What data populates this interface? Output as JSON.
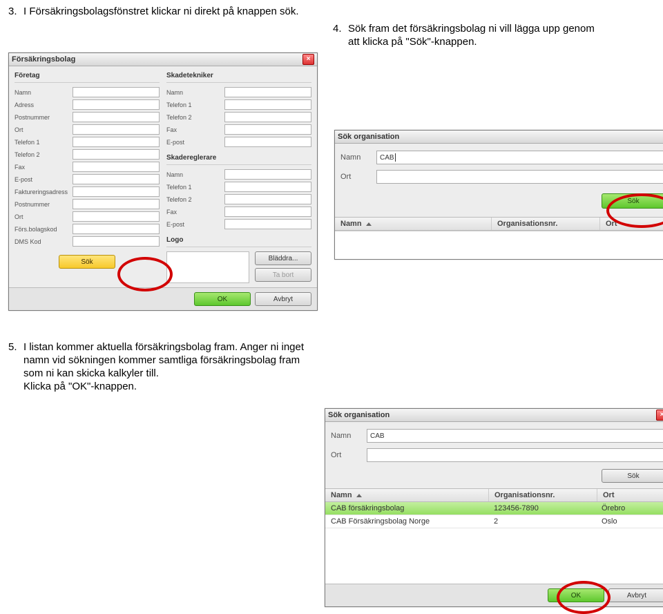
{
  "instr3": {
    "num": "3.",
    "text": "I Försäkringsbolagsfönstret klickar ni direkt på knappen sök."
  },
  "instr4": {
    "num": "4.",
    "text": "Sök fram det försäkringsbolag ni vill lägga upp genom att klicka på \"Sök\"-knappen."
  },
  "instr5": {
    "num": "5.",
    "text": "I listan kommer aktuella försäkrings­bolag fram. Anger ni inget namn vid sökningen kommer samtliga försäk­ringsbolag fram som ni kan skicka kalkyler till.\nKlicka på \"OK\"-knappen."
  },
  "win1": {
    "title": "Försäkringsbolag",
    "company": {
      "heading": "Företag",
      "labels": {
        "namn": "Namn",
        "adress": "Adress",
        "postnr": "Postnummer",
        "ort": "Ort",
        "tel1": "Telefon 1",
        "tel2": "Telefon 2",
        "fax": "Fax",
        "epost": "E-post",
        "faktadr": "Faktureringsadress",
        "postnr2": "Postnummer",
        "ort2": "Ort",
        "bkod": "Förs.bolagskod",
        "dms": "DMS Kod"
      }
    },
    "tech": {
      "heading": "Skadetekniker",
      "labels": {
        "namn": "Namn",
        "tel1": "Telefon 1",
        "tel2": "Telefon 2",
        "fax": "Fax",
        "epost": "E-post"
      }
    },
    "reg": {
      "heading": "Skadereglerare",
      "labels": {
        "namn": "Namn",
        "tel1": "Telefon 1",
        "tel2": "Telefon 2",
        "fax": "Fax",
        "epost": "E-post"
      }
    },
    "logo": "Logo",
    "btns": {
      "sok": "Sök",
      "bladdra": "Bläddra...",
      "tabort": "Ta bort",
      "ok": "OK",
      "avbryt": "Avbryt"
    }
  },
  "win2": {
    "title": "Sök organisation",
    "labels": {
      "namn": "Namn",
      "ort": "Ort"
    },
    "namn_value": "CAB",
    "btn_sok": "Sök",
    "tbl": {
      "namn": "Namn",
      "org": "Organisationsnr.",
      "ort": "Ort"
    }
  },
  "win3": {
    "title": "Sök organisation",
    "labels": {
      "namn": "Namn",
      "ort": "Ort"
    },
    "namn_value": "CAB",
    "btn_sok": "Sök",
    "cols": {
      "namn": "Namn",
      "org": "Organisationsnr.",
      "ort": "Ort"
    },
    "rows": [
      {
        "namn": "CAB försäkringsbolag",
        "org": "123456-7890",
        "ort": "Örebro",
        "sel": true
      },
      {
        "namn": "CAB Försäkringsbolag Norge",
        "org": "2",
        "ort": "Oslo",
        "sel": false
      }
    ],
    "btns": {
      "ok": "OK",
      "avbryt": "Avbryt"
    }
  }
}
